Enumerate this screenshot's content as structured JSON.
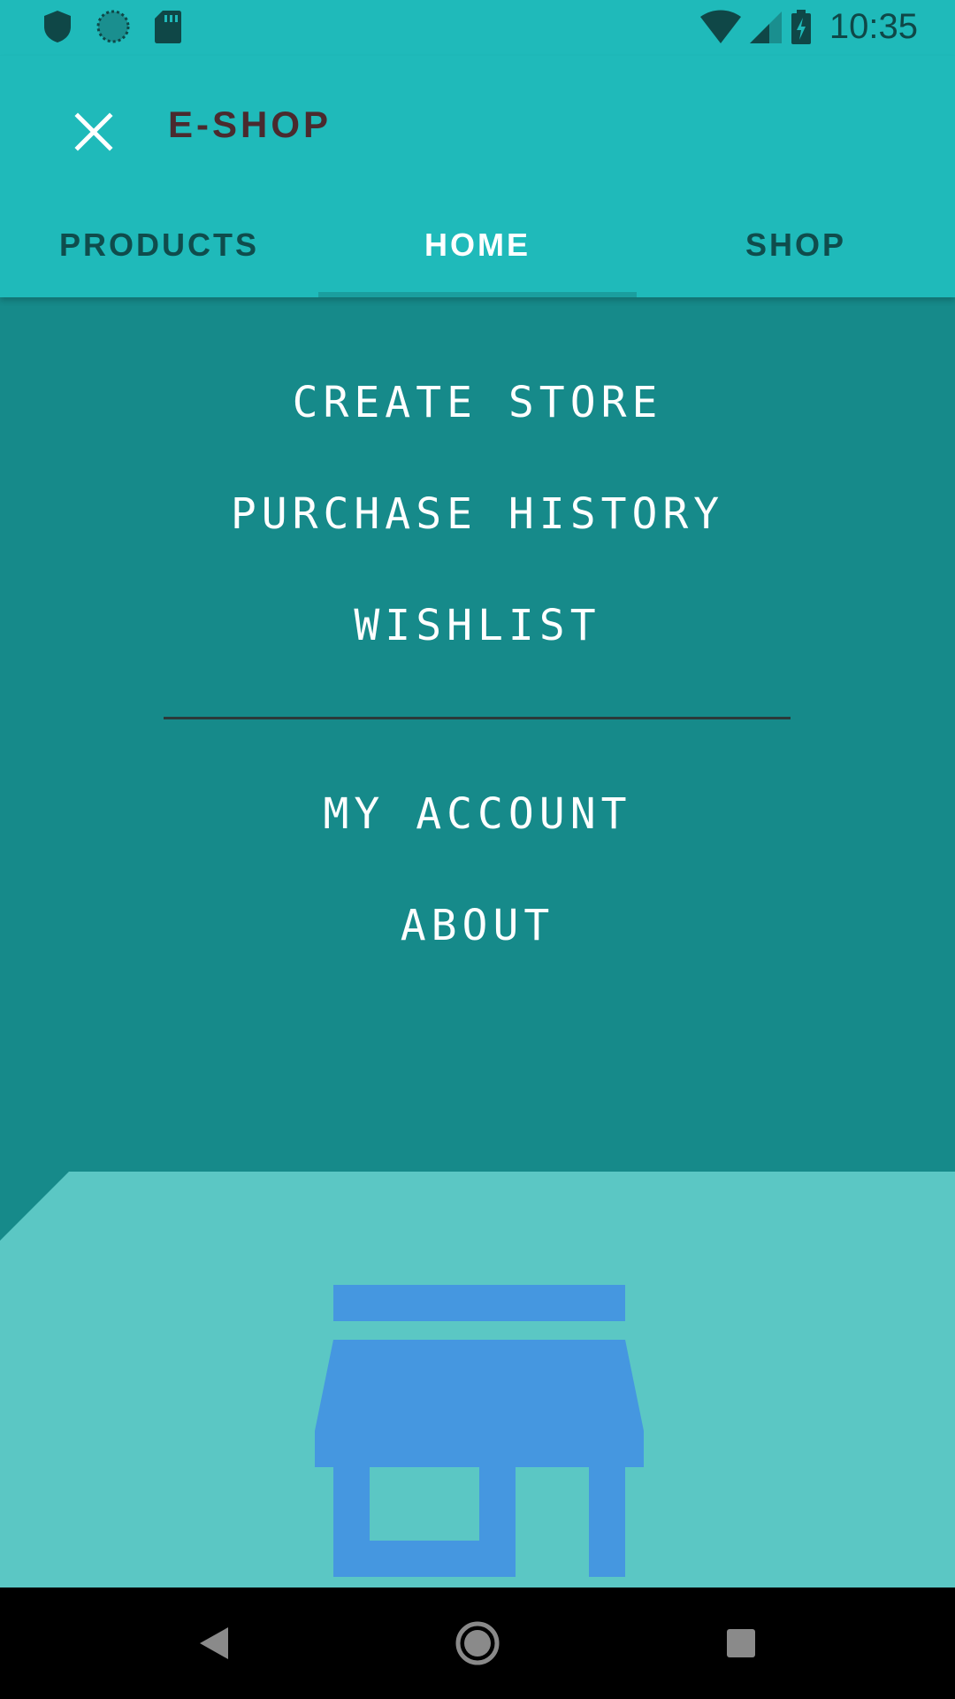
{
  "status_bar": {
    "time": "10:35",
    "icons": [
      "shield-icon",
      "sync-icon",
      "sd-card-icon",
      "wifi-icon",
      "signal-icon",
      "battery-charging-icon"
    ]
  },
  "app_bar": {
    "title": "E-SHOP",
    "close_icon": "close-icon"
  },
  "tabs": [
    {
      "label": "PRODUCTS",
      "active": false
    },
    {
      "label": "HOME",
      "active": true
    },
    {
      "label": "SHOP",
      "active": false
    }
  ],
  "menu": {
    "items": [
      {
        "label": "CREATE STORE"
      },
      {
        "label": "PURCHASE HISTORY"
      },
      {
        "label": "WISHLIST"
      },
      {
        "label": "MY ACCOUNT"
      },
      {
        "label": "ABOUT"
      }
    ]
  },
  "front_layer": {
    "icon": "store-icon"
  },
  "nav_bar": {
    "icons": [
      "back-icon",
      "home-icon",
      "recents-icon"
    ]
  },
  "colors": {
    "primary": "#1fbaba",
    "backdrop": "#168a8a",
    "front_layer": "#5bc7c4",
    "store_icon": "#4597e0",
    "title_text": "#4a2a2e"
  }
}
